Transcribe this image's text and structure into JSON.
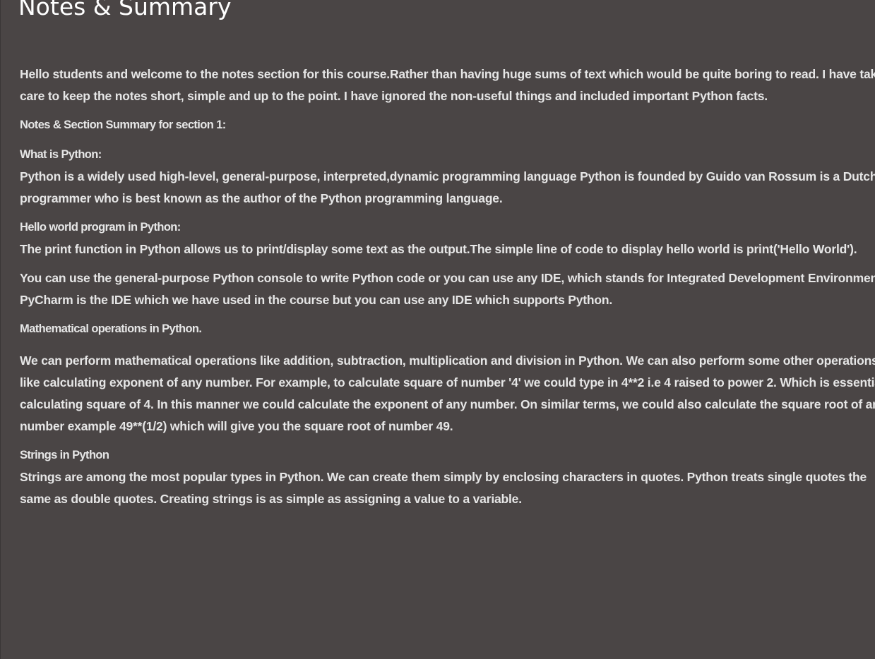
{
  "title": "Notes & Summary",
  "intro": "Hello students and welcome to the notes section for this course.Rather than having huge sums of text which would be quite boring to read. I have taken care to keep the notes short, simple and up to the point. I have ignored the non-useful things and included important Python facts.",
  "section_heading": "Notes & Section Summary for section 1:",
  "what_is_python": {
    "heading": "What is Python:",
    "body": "Python is a widely used high-level, general-purpose, interpreted,dynamic programming language Python is founded by Guido van Rossum is a Dutch programmer who is best known as the author of the Python programming language."
  },
  "hello_world": {
    "heading": "Hello world program in Python:",
    "body": "The print function in Python allows us to print/display some text as the output.The simple line of code to display hello world is print('Hello World').",
    "ide_note": "You can use the general-purpose Python console to write Python code or you can use any IDE, which stands for Integrated Development Environment. PyCharm is the IDE which we have used in the course but you can use any IDE which supports Python."
  },
  "math_ops": {
    "heading": "Mathematical operations in Python.",
    "body": "We can perform mathematical operations like addition, subtraction, multiplication and division in Python. We can also perform some other operations like calculating exponent of any number. For example, to calculate square of number '4' we could type in 4**2 i.e 4 raised to power 2. Which is essentially calculating square of 4. In this manner we could calculate the exponent of any number. On similar terms, we could also calculate the square root of any number example 49**(1/2) which will give you the square root of number 49."
  },
  "strings": {
    "heading": "Strings in Python",
    "body": "Strings are among the most popular types in Python. We can create them simply by enclosing characters in quotes. Python treats single quotes the same as double quotes. Creating strings is as simple as assigning a value to a variable."
  }
}
